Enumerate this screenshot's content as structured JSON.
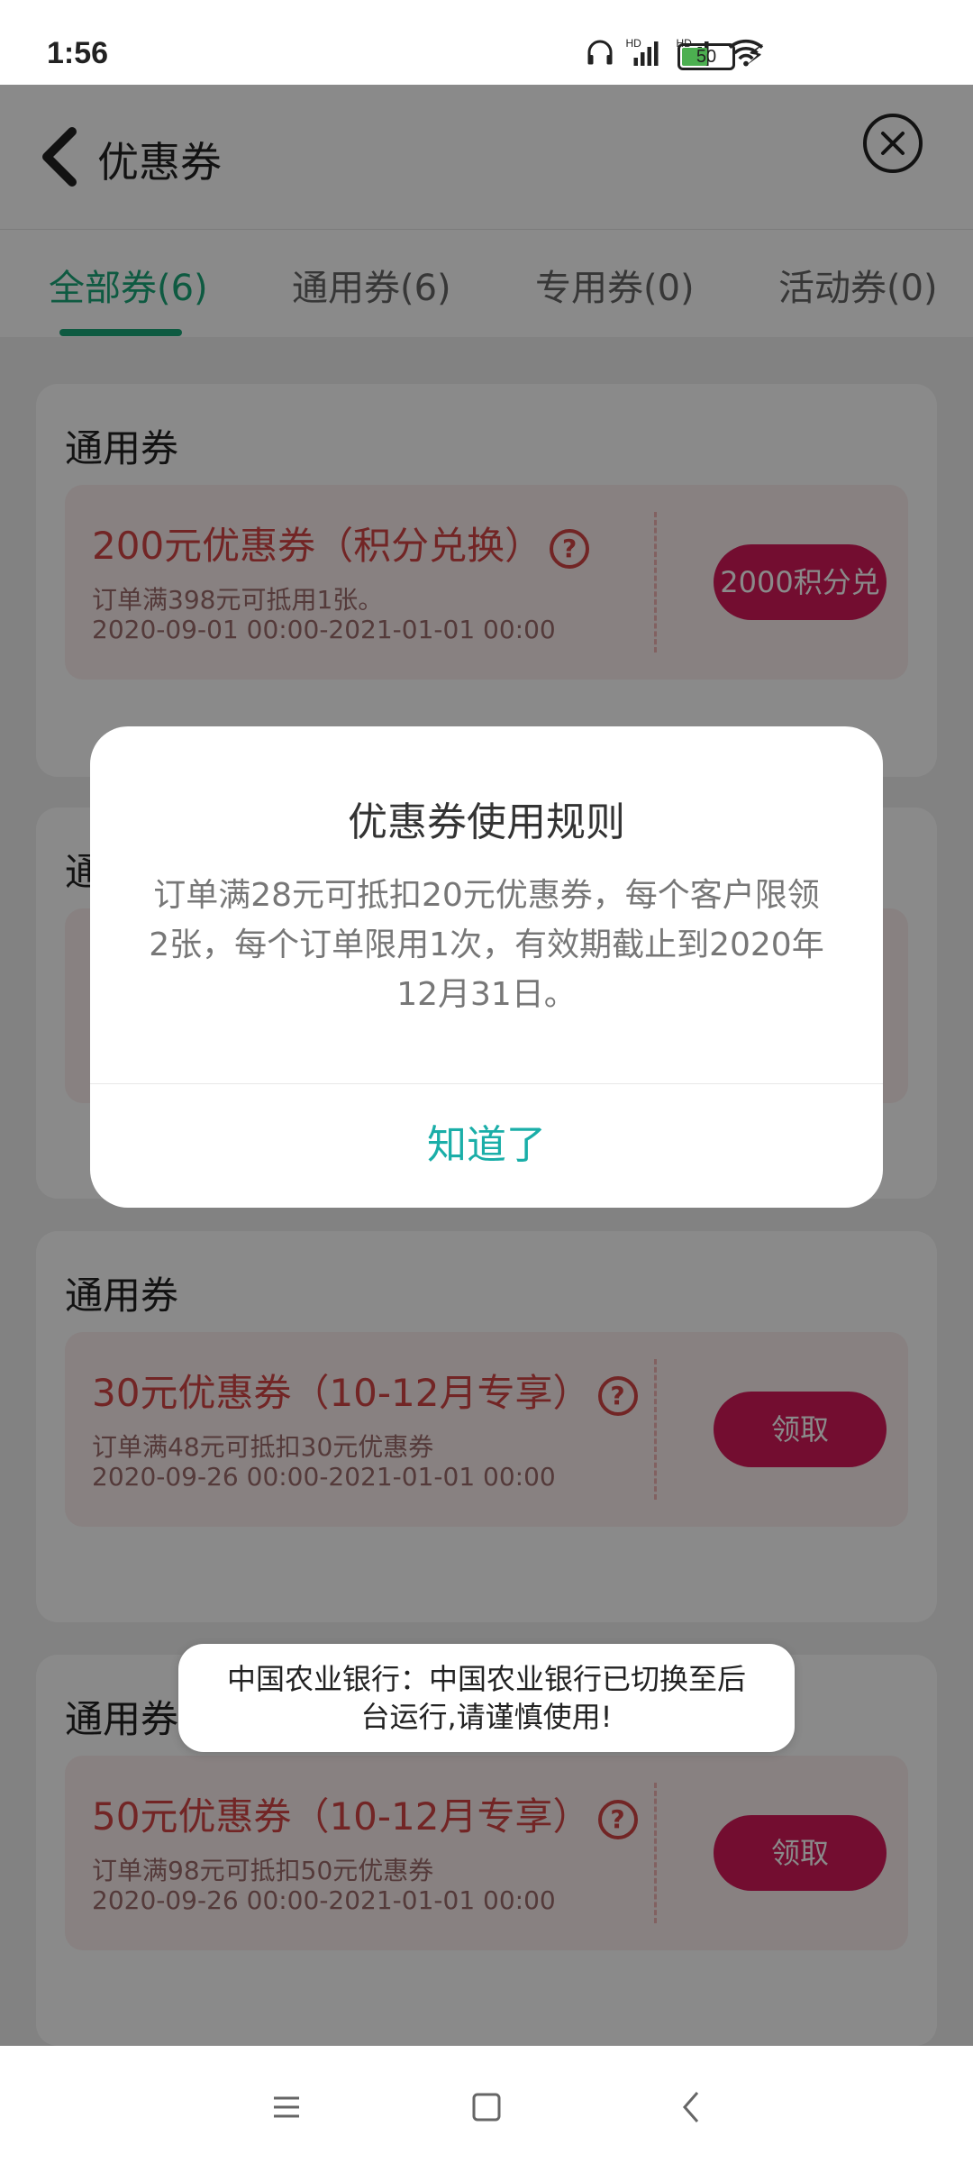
{
  "status_bar": {
    "time": "1:56",
    "battery": "50",
    "icons": [
      "headphones-icon",
      "signal-hd-icon",
      "signal-hd-icon",
      "wifi-icon",
      "charging-icon"
    ]
  },
  "header": {
    "title": "优惠券"
  },
  "tabs": [
    {
      "label": "全部券(6)",
      "active": true
    },
    {
      "label": "通用券(6)",
      "active": false
    },
    {
      "label": "专用券(0)",
      "active": false
    },
    {
      "label": "活动券(0)",
      "active": false
    }
  ],
  "cards": [
    {
      "section_title": "通用券",
      "coupon_name": "200元优惠券（积分兑换）",
      "condition": "订单满398元可抵用1张。",
      "validity": "2020-09-01 00:00-2021-01-01 00:00",
      "action": "2000积分兑"
    },
    {
      "section_title": "通"
    },
    {
      "section_title": "通用券",
      "coupon_name": "30元优惠券（10-12月专享）",
      "condition": "订单满48元可抵扣30元优惠券",
      "validity": "2020-09-26 00:00-2021-01-01 00:00",
      "action": "领取"
    },
    {
      "section_title": "通用券",
      "coupon_name": "50元优惠券（10-12月专享）",
      "condition": "订单满98元可抵扣50元优惠券",
      "validity": "2020-09-26 00:00-2021-01-01 00:00",
      "action": "领取"
    }
  ],
  "dialog": {
    "title": "优惠券使用规则",
    "body": "订单满28元可抵扣20元优惠券，每个客户限领2张，每个订单限用1次，有效期截止到2020年12月31日。",
    "button": "知道了"
  },
  "toast": {
    "message": "中国农业银行：中国农业银行已切换至后台运行,请谨慎使用!"
  },
  "colors": {
    "accent": "#1aa678",
    "coupon_text": "#d24545",
    "coupon_button": "#d4195a",
    "dialog_button": "#1aaea8"
  }
}
